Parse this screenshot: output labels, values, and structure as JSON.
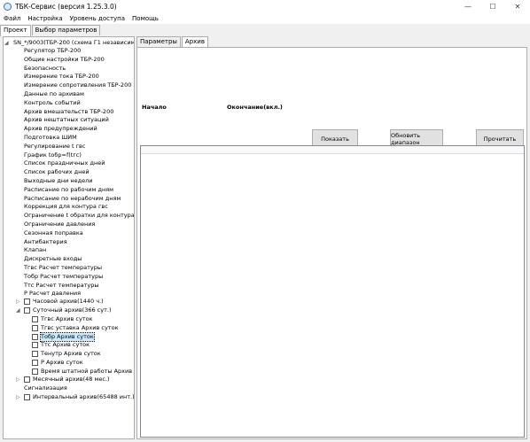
{
  "window": {
    "title": "ТБК-Сервис (версия 1.25.3.0)",
    "controls": {
      "minimize": "—",
      "maximize": "☐",
      "close": "✕"
    }
  },
  "menu": [
    "Файл",
    "Настройка",
    "Уровень доступа",
    "Помощь"
  ],
  "top_tabs": [
    {
      "label": "Проект",
      "active": true
    },
    {
      "label": "Выбор параметров",
      "active": false
    }
  ],
  "tree": {
    "root": "SN_*/9003(ТБР-200 (схема Г1 независимая))",
    "items": [
      "Регулятор ТБР-200",
      "Общие настройки ТБР-200",
      "Безопасность",
      "Измерение тока ТБР-200",
      "Измерение сопротивления  ТБР-200",
      "Данные по архивам",
      "Контроль событий",
      "Архив вмешательств ТБР-200",
      "Архив нештатных ситуаций",
      "Архив предупреждений",
      "Подготовка ШИМ",
      "Регулирование t гвс",
      "График tобр=f(tгс)",
      "Список праздничных дней",
      "Список рабочих  дней",
      "Выходные дни недели",
      "Расписание по рабочим дням",
      "Расписание по нерабочим дням",
      "Коррекция для контура гвс",
      "Ограничение t обратки для контура ГВС",
      "Ограничение давления",
      "Сезонная поправка",
      "Антибактерия",
      "Клапан",
      "Дискретные входы",
      "Tгвс Расчет температуры",
      "Тобр Расчет температуры",
      "Ттс Расчет температуры",
      "Р Расчет давления"
    ],
    "hourly": "Часовой архив(1440 ч.)",
    "daily": "Суточный архив(366 сут.)",
    "daily_children": [
      "Тгвс Архив суток",
      "Тгвс уставка Архив суток",
      "Тобр Архив суток",
      "Ттс Архив суток",
      "Тенутр Архив суток",
      "Р Архив суток",
      "Время штатной работы Архив суток"
    ],
    "monthly": "Месячный архив(48 мес.)",
    "signal": "Сигнализация",
    "interval": "Интервальный архив(65488 инт.)"
  },
  "sub_tabs": [
    {
      "label": "Параметры",
      "active": false
    },
    {
      "label": "Архив",
      "active": true
    }
  ],
  "archive": {
    "start_label": "Начало",
    "end_label": "Окончание(вкл.)",
    "show_button": "Показать",
    "update_range_button": "Обновить диапазон",
    "read_button": "Прочитать"
  }
}
